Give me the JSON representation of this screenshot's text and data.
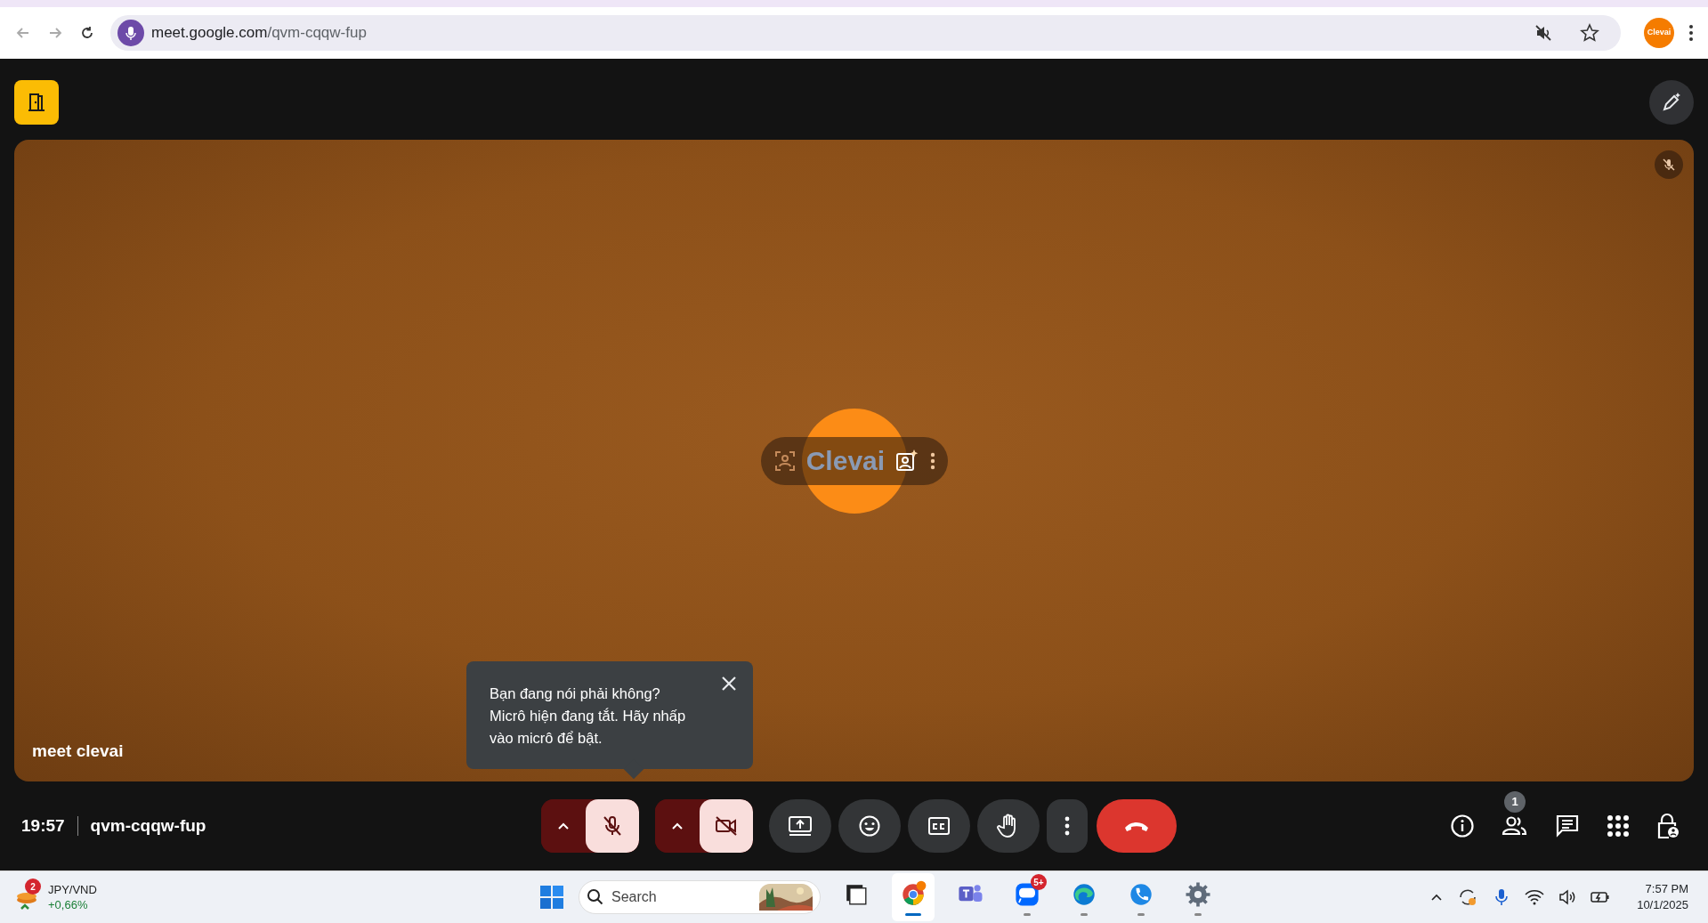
{
  "browser": {
    "url_host": "meet.google.com",
    "url_path": "/qvm-cqqw-fup",
    "profile_label": "Clevai"
  },
  "meeting": {
    "tile_name": "meet clevai",
    "avatar_text": "Clevai",
    "tile_muted": true,
    "tooltip": "Bạn đang nói phải không?\nMicrô hiện đang tắt. Hãy nhấp\nvào micrô để bật.",
    "time": "19:57",
    "code": "qvm-cqqw-fup",
    "mic": {
      "on": false
    },
    "camera": {
      "on": false
    },
    "participants_count": "1"
  },
  "taskbar": {
    "widget": {
      "title": "JPY/VND",
      "change": "+0,66%",
      "badge": "2"
    },
    "search_placeholder": "Search",
    "apps": [
      {
        "kind": "files",
        "running": false,
        "selected": false
      },
      {
        "kind": "chrome",
        "running": true,
        "selected": true
      },
      {
        "kind": "teams",
        "running": false,
        "selected": false
      },
      {
        "kind": "zalo",
        "running": true,
        "selected": false,
        "badge": "5+"
      },
      {
        "kind": "edge",
        "running": true,
        "selected": false
      },
      {
        "kind": "phone",
        "running": true,
        "selected": false
      },
      {
        "kind": "settings",
        "running": true,
        "selected": false
      }
    ],
    "time": "7:57 PM",
    "date": "10/1/2025"
  }
}
